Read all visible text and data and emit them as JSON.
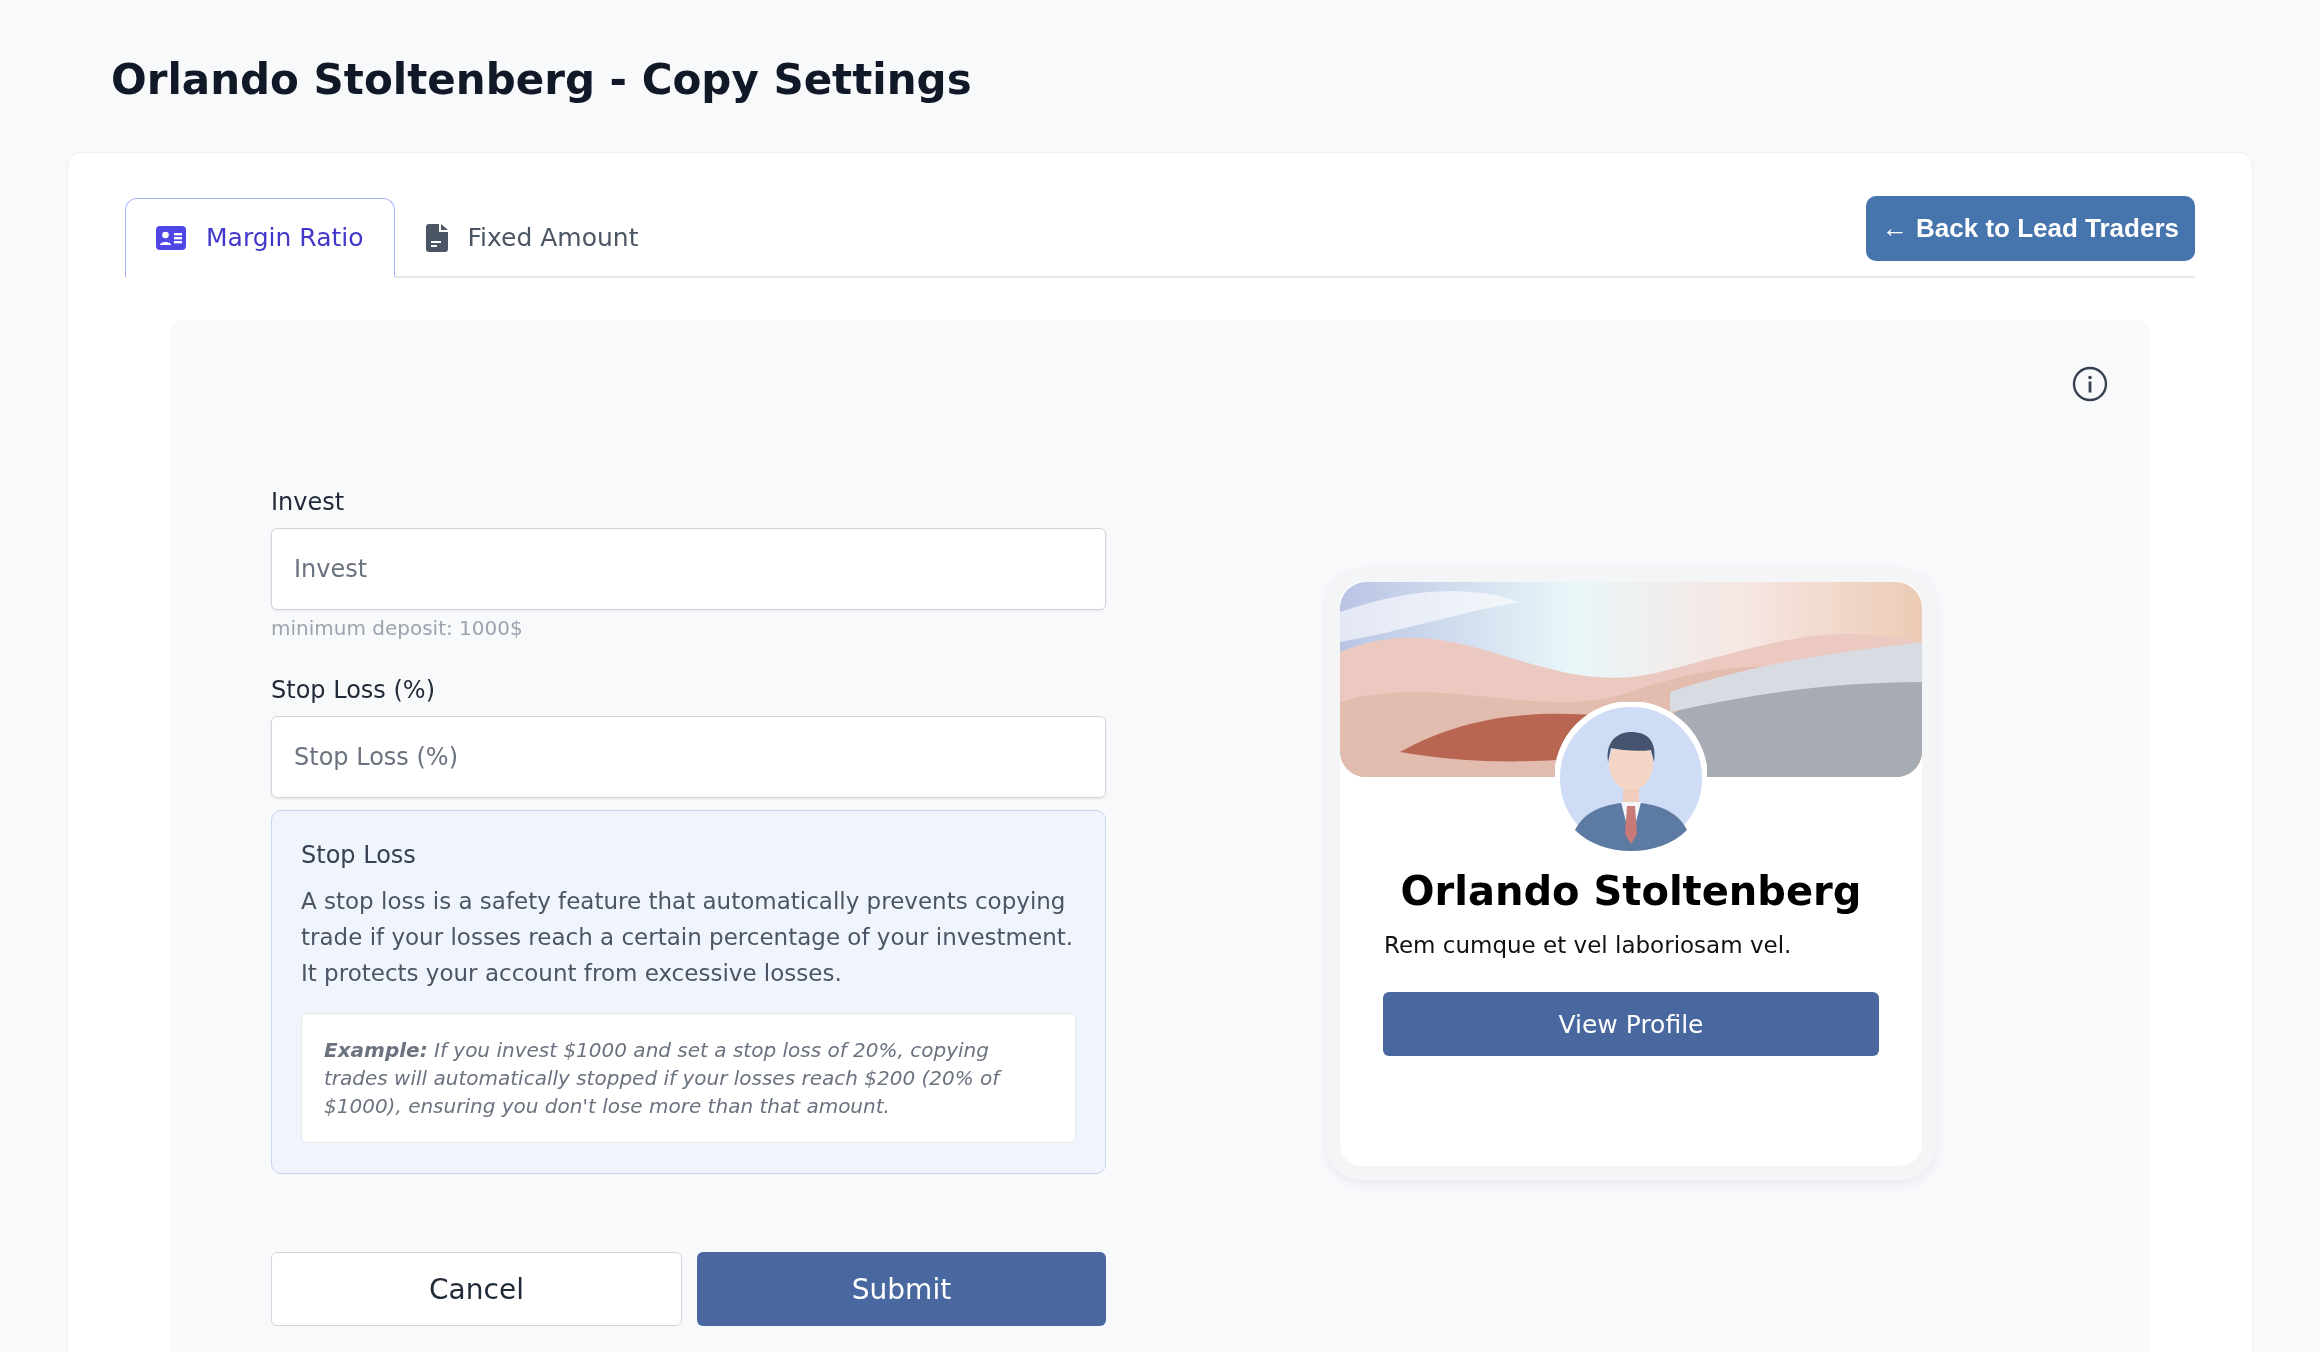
{
  "page_title": "Orlando Stoltenberg - Copy Settings",
  "tabs": [
    {
      "label": "Margin Ratio",
      "selected": true,
      "kind": "card"
    },
    {
      "label": "Fixed Amount",
      "selected": false,
      "kind": "file"
    }
  ],
  "back_button": {
    "icon": "←",
    "label": "Back to Lead Traders"
  },
  "fields": [
    {
      "label": "Invest",
      "placeholder": "Invest",
      "hint": "minimum deposit: 1000$"
    },
    {
      "label": "Stop Loss (%)",
      "placeholder": "Stop Loss (%)"
    }
  ],
  "info_box": {
    "title": "Stop Loss",
    "text": "A stop loss is a safety feature that automatically prevents copying trade if your losses reach a certain percentage of your investment. It protects your account from excessive losses.",
    "example": "**Example:** If you invest $1000 and set a stop loss of 20%, copying trades will automatically stopped if your losses reach $200 (20% of $1000), ensuring you don't lose more than that amount."
  },
  "actions": {
    "cancel": "Cancel",
    "submit": "Submit"
  },
  "profile_card": {
    "name": "Orlando Stoltenberg",
    "bio": "Rem cumque et vel laboriosam vel.",
    "button": "View Profile"
  }
}
